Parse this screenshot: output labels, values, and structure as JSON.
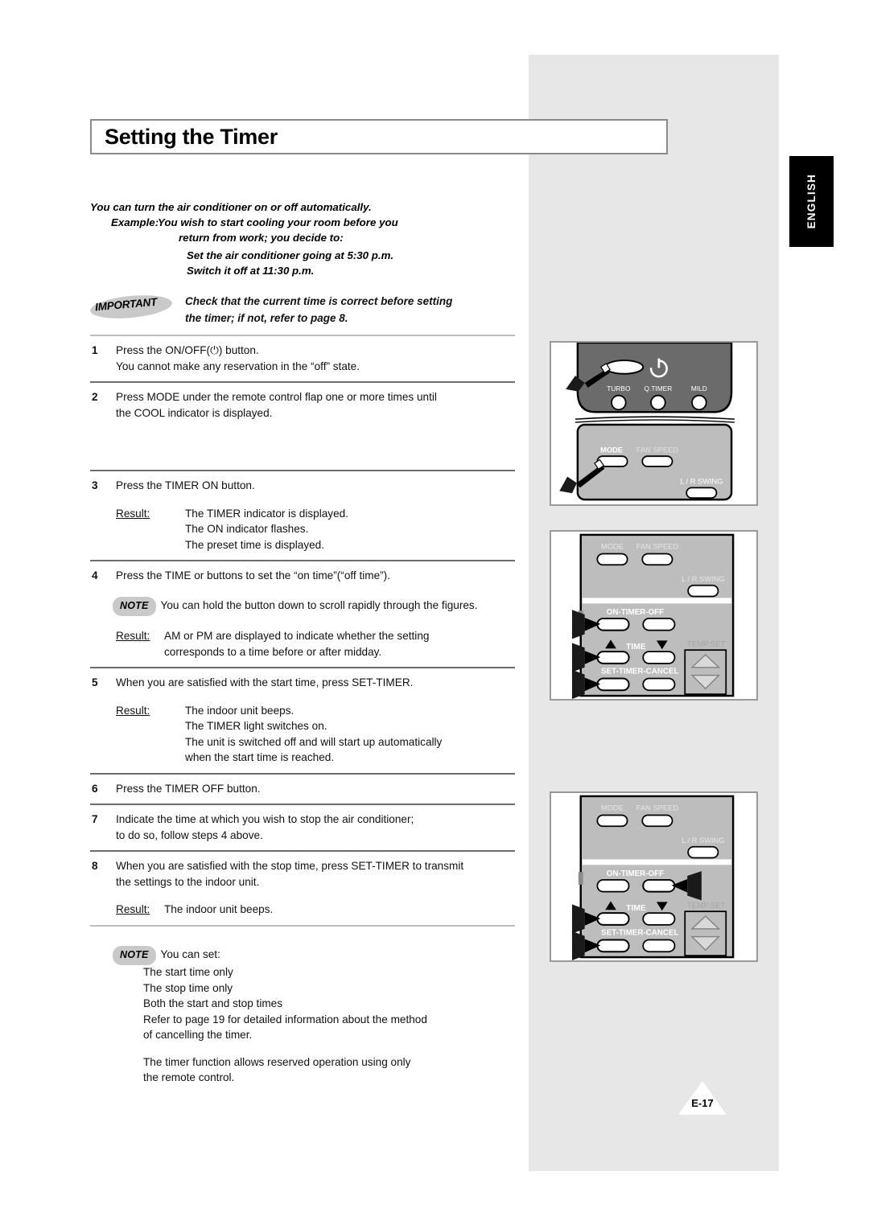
{
  "page": {
    "title": "Setting the Timer",
    "language_tab": "ENGLISH",
    "page_number": "E-17"
  },
  "intro": {
    "line1": "You can turn the air conditioner on or off automatically.",
    "example_label": "Example:",
    "example_line1": "You wish to start cooling your room before you",
    "example_line2": "return from work; you decide to:",
    "example_line3": "Set the air conditioner going at 5:30 p.m.",
    "example_line4": "Switch it off at 11:30 p.m."
  },
  "important": {
    "badge": "IMPORTANT",
    "line1": "Check that the current time is correct before setting",
    "line2": "the timer; if not, refer to page 8."
  },
  "steps": [
    {
      "num": "1",
      "line1": "Press the ON/OFF(⏻) button.",
      "line2": "You cannot make any reservation in the “off” state."
    },
    {
      "num": "2",
      "line1": "Press MODE under the remote control flap one or more times until",
      "line2": "the COOL indicator is displayed."
    },
    {
      "num": "3",
      "line1": "Press the TIMER ON button.",
      "result_label": "Result:",
      "result_lines": [
        "The TIMER indicator is displayed.",
        "The ON indicator flashes.",
        "The preset time is displayed."
      ]
    },
    {
      "num": "4",
      "line1": "Press the TIME      or      buttons to set the “on time”(“off time”).",
      "note_badge": "NOTE",
      "note_text": "You can hold the button down to scroll rapidly through the figures.",
      "result_label": "Result:",
      "result_lines": [
        "AM or PM are displayed to indicate whether the setting",
        "corresponds to a time before or after midday."
      ]
    },
    {
      "num": "5",
      "line1": "When you are satisfied with the start time, press SET-TIMER.",
      "result_label": "Result:",
      "result_lines": [
        "The indoor unit beeps.",
        "The TIMER light switches on.",
        "The unit is switched off and will start up automatically",
        " when the start time is reached."
      ]
    },
    {
      "num": "6",
      "line1": "Press the TIMER OFF button."
    },
    {
      "num": "7",
      "line1": "Indicate the time at which you wish to stop the air conditioner;",
      "line2": "to do so, follow steps 4 above."
    },
    {
      "num": "8",
      "line1": "When you are satisfied with the stop time, press SET-TIMER to transmit",
      "line2": "the settings to the indoor unit.",
      "result_label": "Result:",
      "result_lines": [
        "The indoor unit beeps."
      ]
    }
  ],
  "final_note": {
    "badge": "NOTE",
    "intro": "You can set:",
    "lines": [
      "The start time only",
      "The stop time only",
      "Both the start and stop times",
      "Refer to page 19 for detailed information about the method",
      " of cancelling the timer."
    ],
    "closing_line1": "The timer function allows reserved operation using only",
    "closing_line2": "the remote control."
  },
  "remotes": [
    {
      "id": "remote-top",
      "labels": [
        "TURBO",
        "Q.TIMER",
        "MILD",
        "MODE",
        "FAN SPEED",
        "L / R SWING"
      ],
      "power_icon": "power-icon",
      "pointers": [
        "power-button-pointer",
        "mode-button-pointer"
      ]
    },
    {
      "id": "remote-middle",
      "labels": [
        "MODE",
        "FAN SPEED",
        "L / R SWING",
        "ON-TIMER-OFF",
        "TIME",
        "TEMP.SET",
        "SET-TIMER-CANCEL"
      ],
      "pointers": [
        "on-timer-pointer",
        "time-up-pointer",
        "set-timer-pointer"
      ]
    },
    {
      "id": "remote-bottom",
      "labels": [
        "MODE",
        "FAN SPEED",
        "L / R SWING",
        "ON-TIMER-OFF",
        "TIME",
        "TEMP.SET",
        "SET-TIMER-CANCEL"
      ],
      "pointers": [
        "timer-off-pointer",
        "time-up-pointer",
        "set-timer-pointer"
      ]
    }
  ],
  "colors": {
    "panel_gray": "#e7e7e7",
    "badge_gray": "#c9c9c9",
    "remote_dark": "#6b6b6b",
    "remote_light": "#bdbdbd",
    "rule_gray": "#bdbdbd",
    "tab_black": "#000000"
  }
}
